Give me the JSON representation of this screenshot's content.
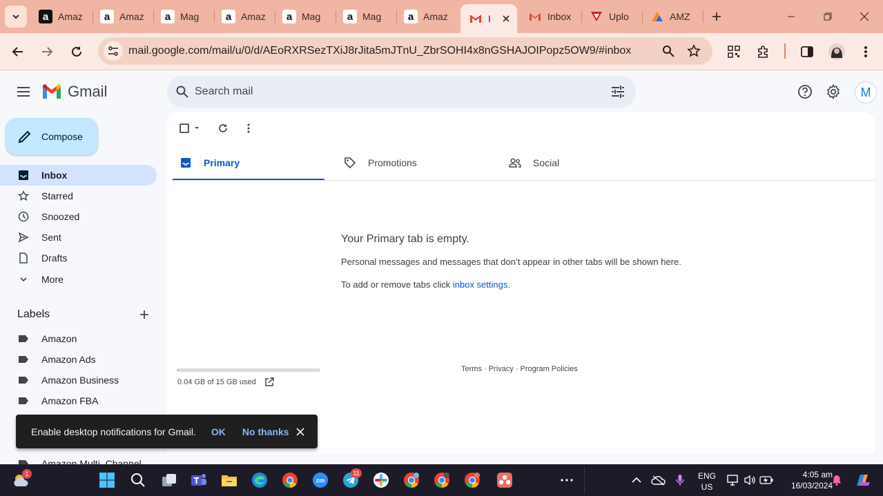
{
  "browser": {
    "tabs": [
      {
        "title": "Amaz",
        "favicon": "amazon-dark-icon"
      },
      {
        "title": "Amaz",
        "favicon": "amazon-icon"
      },
      {
        "title": "Mag",
        "favicon": "amazon-icon"
      },
      {
        "title": "Amaz",
        "favicon": "amazon-icon"
      },
      {
        "title": "Mag",
        "favicon": "amazon-icon"
      },
      {
        "title": "Mag",
        "favicon": "amazon-icon"
      },
      {
        "title": "Amaz",
        "favicon": "amazon-icon"
      },
      {
        "title": "I",
        "favicon": "gmail-icon",
        "active": true
      },
      {
        "title": "Inbox",
        "favicon": "gmail-icon"
      },
      {
        "title": "Uplo",
        "favicon": "vidiq-icon"
      },
      {
        "title": "AMZ",
        "favicon": "amz-icon"
      }
    ],
    "url": "mail.google.com/mail/u/0/d/AEoRXRSezTXiJ8rJita5mJTnU_ZbrSOHI4x8nGSHAJOIPopz5OW9/#inbox",
    "accent": "#f0b6a3"
  },
  "gmail": {
    "logo_text": "Gmail",
    "search_placeholder": "Search mail",
    "account_initial": "M",
    "compose_label": "Compose",
    "nav": [
      {
        "label": "Inbox",
        "icon": "inbox-icon",
        "active": true
      },
      {
        "label": "Starred",
        "icon": "star-icon"
      },
      {
        "label": "Snoozed",
        "icon": "clock-icon"
      },
      {
        "label": "Sent",
        "icon": "send-icon"
      },
      {
        "label": "Drafts",
        "icon": "draft-icon"
      },
      {
        "label": "More",
        "icon": "chevron-down-icon"
      }
    ],
    "labels_header": "Labels",
    "labels": [
      "Amazon",
      "Amazon Ads",
      "Amazon Business",
      "Amazon FBA",
      "Amazon Multi_Channel"
    ],
    "category_tabs": [
      {
        "label": "Primary",
        "icon": "inbox-icon",
        "active": true
      },
      {
        "label": "Promotions",
        "icon": "tag-icon"
      },
      {
        "label": "Social",
        "icon": "people-icon"
      }
    ],
    "empty": {
      "title": "Your Primary tab is empty.",
      "subtitle": "Personal messages and messages that don’t appear in other tabs will be shown here.",
      "settings_prefix": "To add or remove tabs click ",
      "settings_link": "inbox settings",
      "settings_suffix": "."
    },
    "storage": {
      "text": "0.04 GB of 15 GB used",
      "fraction": 0.003
    },
    "footer": "Terms · Privacy · Program Policies",
    "snackbar": {
      "message": "Enable desktop notifications for Gmail.",
      "ok": "OK",
      "no_thanks": "No thanks"
    }
  },
  "taskbar": {
    "weather_badge": "1",
    "telegram_badge": "11",
    "language": "ENG",
    "region": "US",
    "time": "4:05 am",
    "date": "16/03/2024"
  }
}
